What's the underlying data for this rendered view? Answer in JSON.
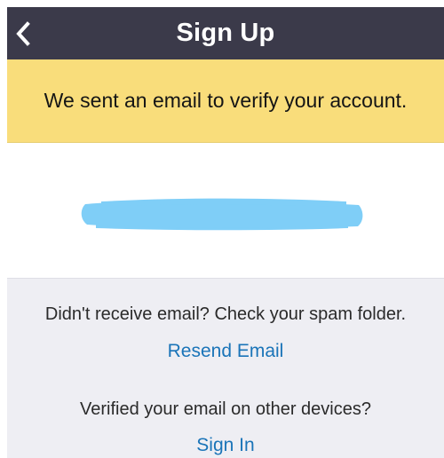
{
  "header": {
    "title": "Sign Up",
    "back_icon": "chevron-left-icon"
  },
  "banner": {
    "message": "We sent an email to verify your account."
  },
  "email": {
    "redaction_color": "#7fcef7"
  },
  "help": {
    "spam_prompt": "Didn't receive email? Check your spam folder.",
    "resend_link": "Resend Email",
    "other_devices_prompt": "Verified your email on other devices?",
    "sign_in_link": "Sign In"
  },
  "colors": {
    "header_bg": "#3b3a4a",
    "banner_bg": "#f9dd7b",
    "panel_bg": "#eeeef3",
    "link": "#1a74b8"
  }
}
